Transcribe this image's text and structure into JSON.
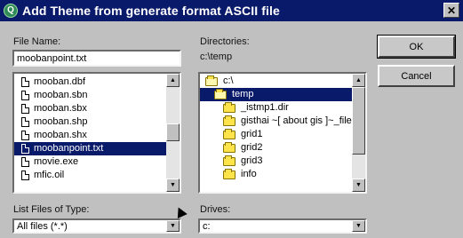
{
  "window": {
    "title": "Add Theme from generate format ASCII file",
    "app_icon": "globe-icon",
    "close_glyph": "✕"
  },
  "file_name": {
    "label": "File Name:",
    "value": "moobanpoint.txt"
  },
  "files": {
    "items": [
      {
        "name": "mooban.dbf",
        "icon": "file-icon"
      },
      {
        "name": "mooban.sbn",
        "icon": "file-icon"
      },
      {
        "name": "mooban.sbx",
        "icon": "file-icon"
      },
      {
        "name": "mooban.shp",
        "icon": "file-icon"
      },
      {
        "name": "mooban.shx",
        "icon": "file-icon"
      },
      {
        "name": "moobanpoint.txt",
        "icon": "file-icon",
        "selected": true
      },
      {
        "name": "movie.exe",
        "icon": "file-icon"
      },
      {
        "name": "mfic.oil",
        "icon": "file-icon"
      }
    ]
  },
  "directories": {
    "label": "Directories:",
    "current_path": "c:\\temp",
    "items": [
      {
        "name": "c:\\",
        "icon": "open-folder-icon",
        "level": 0
      },
      {
        "name": "temp",
        "icon": "open-folder-icon",
        "level": 1,
        "selected": true
      },
      {
        "name": "_istmp1.dir",
        "icon": "folder-icon",
        "level": 2
      },
      {
        "name": "gisthai ~[ about gis ]~_file",
        "icon": "folder-icon",
        "level": 2
      },
      {
        "name": "grid1",
        "icon": "folder-icon",
        "level": 2
      },
      {
        "name": "grid2",
        "icon": "folder-icon",
        "level": 2
      },
      {
        "name": "grid3",
        "icon": "folder-icon",
        "level": 2
      },
      {
        "name": "info",
        "icon": "folder-icon",
        "level": 2
      }
    ]
  },
  "buttons": {
    "ok": "OK",
    "cancel": "Cancel"
  },
  "file_type": {
    "label": "List Files of Type:",
    "value": "All files (*.*)"
  },
  "drives": {
    "label": "Drives:",
    "value": "c:"
  },
  "colors": {
    "titlebar": "#0a1a6b",
    "selection": "#0a1a6b",
    "dialog_bg": "#c0c0c0"
  }
}
